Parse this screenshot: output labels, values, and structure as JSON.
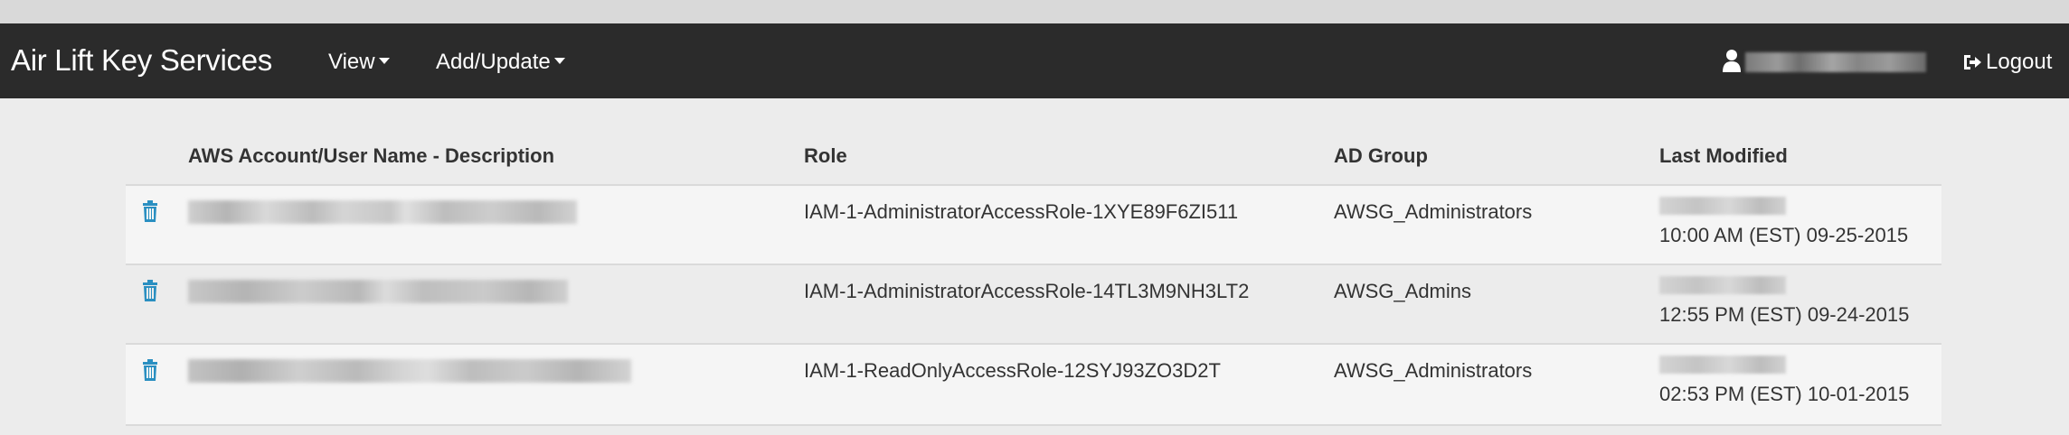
{
  "navbar": {
    "brand": "Air Lift Key Services",
    "menu": [
      {
        "label": "View"
      },
      {
        "label": "Add/Update"
      }
    ],
    "logout_label": "Logout"
  },
  "table": {
    "headers": {
      "account": "AWS Account/User Name - Description",
      "role": "Role",
      "ad_group": "AD Group",
      "last_modified": "Last Modified"
    },
    "rows": [
      {
        "role": "IAM-1-AdministratorAccessRole-1XYE89F6ZI511",
        "ad_group": "AWSG_Administrators",
        "last_modified_time": "10:00 AM (EST) 09-25-2015"
      },
      {
        "role": "IAM-1-AdministratorAccessRole-14TL3M9NH3LT2",
        "ad_group": "AWSG_Admins",
        "last_modified_time": "12:55 PM (EST) 09-24-2015"
      },
      {
        "role": "IAM-1-ReadOnlyAccessRole-12SYJ93ZO3D2T",
        "ad_group": "AWSG_Administrators",
        "last_modified_time": "02:53 PM (EST) 10-01-2015"
      }
    ]
  },
  "colors": {
    "navbar_bg": "#2b2b2b",
    "page_bg": "#ececec",
    "row_alt_bg": "#f5f5f5",
    "trash_icon": "#2a8fc1",
    "text": "#333333"
  },
  "icons": {
    "user": "user-icon",
    "logout": "sign-out-icon",
    "delete": "trash-icon",
    "dropdown": "caret-down-icon"
  }
}
